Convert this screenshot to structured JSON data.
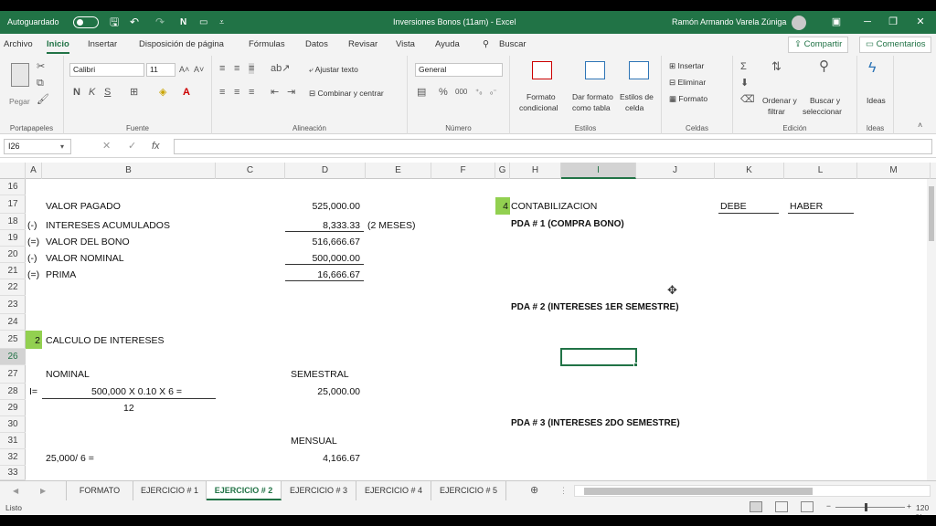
{
  "titlebar": {
    "autosave_label": "Autoguardado",
    "title": "Inversiones Bonos (11am)  -  Excel",
    "user": "Ramón Armando Varela Zúniga"
  },
  "menu": [
    "Archivo",
    "Inicio",
    "Insertar",
    "Disposición de página",
    "Fórmulas",
    "Datos",
    "Revisar",
    "Vista",
    "Ayuda",
    "Buscar"
  ],
  "share_label": "Compartir",
  "comments_label": "Comentarios",
  "ribbon": {
    "paste_label": "Pegar",
    "clipboard_group": "Portapapeles",
    "font_name": "Calibri",
    "font_size": "11",
    "font_group": "Fuente",
    "wrap_text": "Ajustar texto",
    "merge_center": "Combinar y centrar",
    "alignment_group": "Alineación",
    "number_format": "General",
    "number_group": "Número",
    "cond_format_1": "Formato",
    "cond_format_2": "condicional",
    "format_table_1": "Dar formato",
    "format_table_2": "como tabla",
    "cell_styles_1": "Estilos de",
    "cell_styles_2": "celda",
    "styles_group": "Estilos",
    "insert_label": "Insertar",
    "delete_label": "Eliminar",
    "format_label": "Formato",
    "cells_group": "Celdas",
    "sort_1": "Ordenar y",
    "sort_2": "filtrar",
    "find_1": "Buscar y",
    "find_2": "seleccionar",
    "editing_group": "Edición",
    "ideas_label": "Ideas",
    "ideas_group": "Ideas"
  },
  "namebox": "I26",
  "columns": [
    "A",
    "B",
    "C",
    "D",
    "E",
    "F",
    "G",
    "H",
    "I",
    "J",
    "K",
    "L",
    "M"
  ],
  "rows": [
    "16",
    "17",
    "18",
    "19",
    "20",
    "21",
    "22",
    "23",
    "24",
    "25",
    "26",
    "27",
    "28",
    "29",
    "30",
    "31",
    "32",
    "33"
  ],
  "cells": {
    "b17": "VALOR PAGADO",
    "d17": "525,000.00",
    "a18": "(-)",
    "b18": "INTERESES ACUMULADOS",
    "d18": "8,333.33",
    "e18": "(2 MESES)",
    "a19": "(=)",
    "b19": "VALOR DEL BONO",
    "d19": "516,666.67",
    "a20": "(-)",
    "b20": "VALOR NOMINAL",
    "d20": "500,000.00",
    "a21": "(=)",
    "b21": "PRIMA",
    "d21": "16,666.67",
    "a25": "2",
    "b25": "CALCULO DE INTERESES",
    "b27": "NOMINAL",
    "d27": "SEMESTRAL",
    "a28": "I=",
    "b28": "500,000 X 0.10 X 6 =",
    "d28": "25,000.00",
    "b29": "12",
    "d31": "MENSUAL",
    "b32": "25,000/ 6 =",
    "d32": "4,166.67",
    "g17": "4",
    "h17": "CONTABILIZACION",
    "k17": "DEBE",
    "l17": "HABER",
    "h18": "PDA # 1 (COMPRA BONO)",
    "h23": "PDA # 2 (INTERESES 1ER SEMESTRE)",
    "h30": "PDA # 3 (INTERESES 2DO SEMESTRE)"
  },
  "sheets": [
    "FORMATO",
    "EJERCICIO # 1",
    "EJERCICIO # 2",
    "EJERCICIO # 3",
    "EJERCICIO # 4",
    "EJERCICIO # 5"
  ],
  "active_sheet": "EJERCICIO # 2",
  "status": {
    "ready": "Listo",
    "zoom": "120 %"
  },
  "colors": {
    "excel_green": "#217346",
    "highlight_green": "#92d050"
  }
}
